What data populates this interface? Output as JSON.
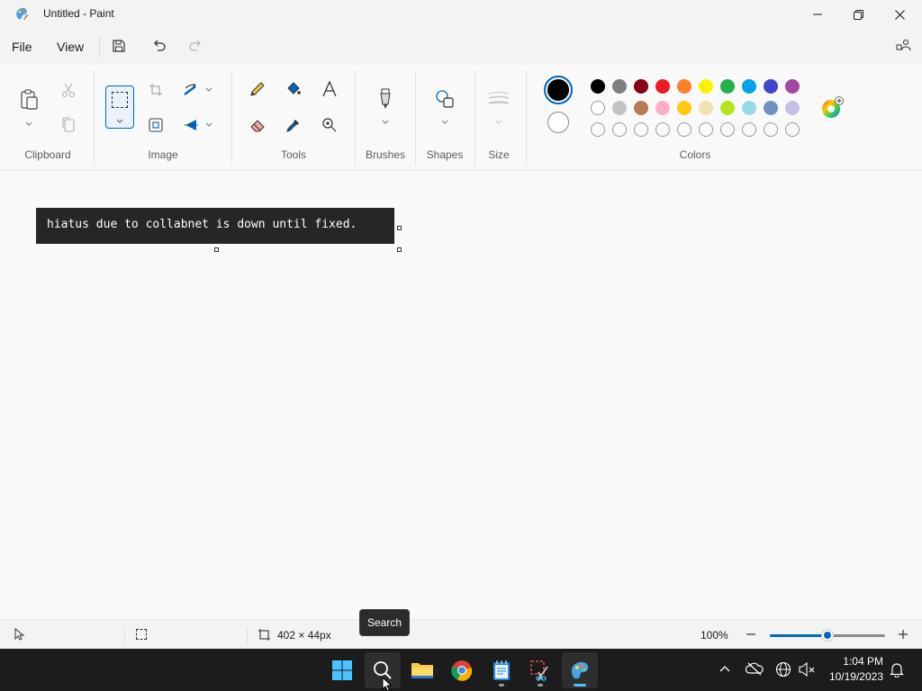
{
  "window": {
    "title": "Untitled - Paint",
    "app_icon": "paint-icon"
  },
  "menu": {
    "file": "File",
    "view": "View"
  },
  "ribbon": {
    "groups": {
      "clipboard": "Clipboard",
      "image": "Image",
      "tools": "Tools",
      "brushes": "Brushes",
      "shapes": "Shapes",
      "size": "Size",
      "colors": "Colors"
    },
    "primary_color": "#000000",
    "secondary_color": "#ffffff",
    "palette_row1": [
      "#000000",
      "#7f7f7f",
      "#880015",
      "#ed1c24",
      "#ff7f27",
      "#fff200",
      "#22b14c",
      "#00a2e8",
      "#3f48cc",
      "#a349a4"
    ],
    "palette_row2": [
      "#ffffff",
      "#c3c3c3",
      "#b97a57",
      "#ffaec9",
      "#ffc90e",
      "#efe4b0",
      "#b5e61d",
      "#99d9ea",
      "#7092be",
      "#c8bfe7"
    ],
    "palette_row3_empty_count": 10
  },
  "canvas": {
    "text": "hiatus due to collabnet is down until fixed."
  },
  "tooltip": {
    "text": "Search"
  },
  "status": {
    "selection_size": "402 × 44px",
    "zoom": "100%",
    "zoom_level": 0.5
  },
  "taskbar": {
    "apps": [
      "start-icon",
      "search-icon",
      "file-explorer-icon",
      "chrome-icon",
      "notepad-icon",
      "snipping-tool-icon",
      "paint-icon"
    ],
    "time": "1:04 PM",
    "date": "10/19/2023"
  },
  "colors": {
    "accent": "#0067c0",
    "taskbar": "#1c1c1c"
  }
}
